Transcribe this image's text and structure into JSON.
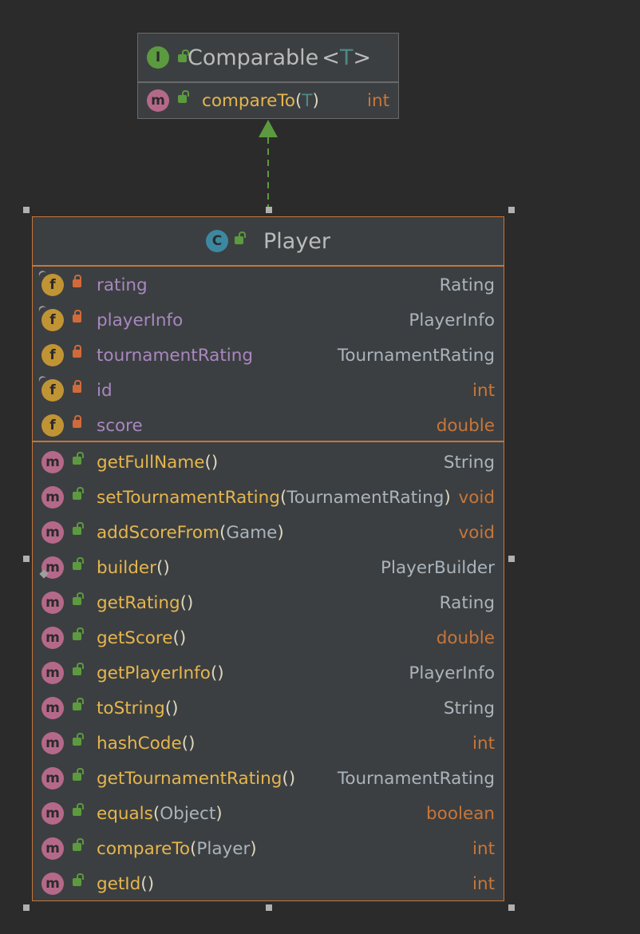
{
  "interface": {
    "badge": "I",
    "name": "Comparable",
    "generic_open": "<",
    "generic_param": "T",
    "generic_close": ">",
    "method": {
      "badge": "m",
      "name": "compareTo",
      "open": "(",
      "param": "T",
      "close": ")",
      "type": "int"
    }
  },
  "class": {
    "badge": "C",
    "name": "Player",
    "fields": [
      {
        "badge": "f",
        "name": "rating",
        "type": "Rating",
        "primitive": false,
        "final": true
      },
      {
        "badge": "f",
        "name": "playerInfo",
        "type": "PlayerInfo",
        "primitive": false,
        "final": true
      },
      {
        "badge": "f",
        "name": "tournamentRating",
        "type": "TournamentRating",
        "primitive": false,
        "final": false
      },
      {
        "badge": "f",
        "name": "id",
        "type": "int",
        "primitive": true,
        "final": true
      },
      {
        "badge": "f",
        "name": "score",
        "type": "double",
        "primitive": true,
        "final": false
      }
    ],
    "methods": [
      {
        "badge": "m",
        "name": "getFullName",
        "param": "",
        "type": "String",
        "primitive": false,
        "static": false
      },
      {
        "badge": "m",
        "name": "setTournamentRating",
        "param": "TournamentRating",
        "type": "void",
        "primitive": true,
        "static": false
      },
      {
        "badge": "m",
        "name": "addScoreFrom",
        "param": "Game",
        "type": "void",
        "primitive": true,
        "static": false
      },
      {
        "badge": "m",
        "name": "builder",
        "param": "",
        "type": "PlayerBuilder",
        "primitive": false,
        "static": true
      },
      {
        "badge": "m",
        "name": "getRating",
        "param": "",
        "type": "Rating",
        "primitive": false,
        "static": false
      },
      {
        "badge": "m",
        "name": "getScore",
        "param": "",
        "type": "double",
        "primitive": true,
        "static": false
      },
      {
        "badge": "m",
        "name": "getPlayerInfo",
        "param": "",
        "type": "PlayerInfo",
        "primitive": false,
        "static": false
      },
      {
        "badge": "m",
        "name": "toString",
        "param": "",
        "type": "String",
        "primitive": false,
        "static": false
      },
      {
        "badge": "m",
        "name": "hashCode",
        "param": "",
        "type": "int",
        "primitive": true,
        "static": false
      },
      {
        "badge": "m",
        "name": "getTournamentRating",
        "param": "",
        "type": "TournamentRating",
        "primitive": false,
        "static": false
      },
      {
        "badge": "m",
        "name": "equals",
        "param": "Object",
        "type": "boolean",
        "primitive": true,
        "static": false
      },
      {
        "badge": "m",
        "name": "compareTo",
        "param": "Player",
        "type": "int",
        "primitive": true,
        "static": false
      },
      {
        "badge": "m",
        "name": "getId",
        "param": "",
        "type": "int",
        "primitive": true,
        "static": false
      }
    ],
    "paren_open": "(",
    "paren_close": ")"
  },
  "colors": {
    "background": "#2b2b2b",
    "node_fill": "#3c3f41",
    "class_border": "#c7763a",
    "interface_border": "#6a6a6a",
    "arrow": "#5c9a3f",
    "method_name": "#e6b64d",
    "field_name": "#a987c0",
    "primitive_type": "#c7763a",
    "reference_type": "#aab4bd"
  }
}
